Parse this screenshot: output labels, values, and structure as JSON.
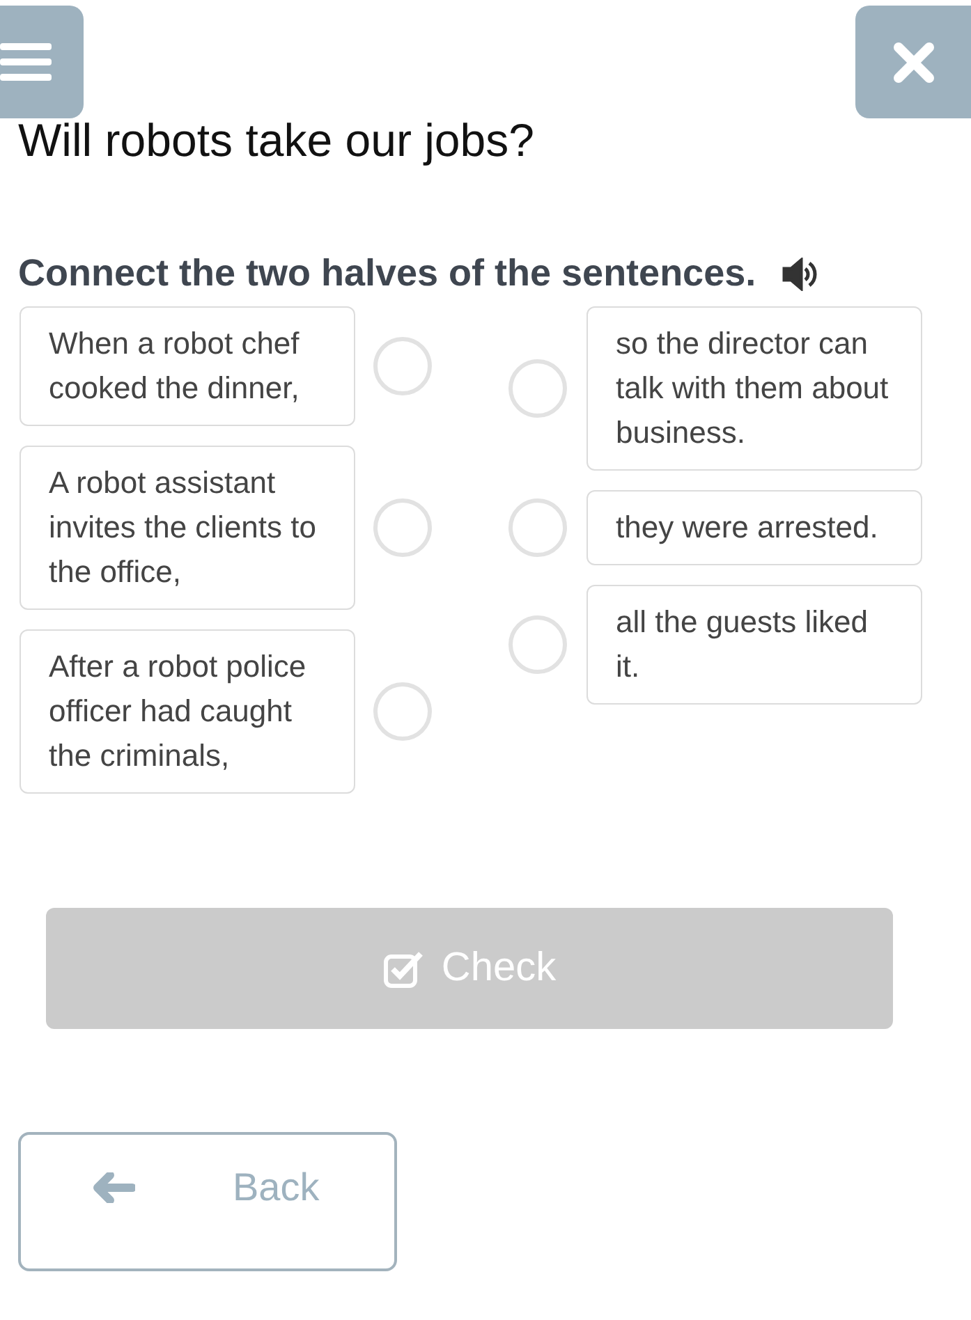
{
  "title": "Will robots take our jobs?",
  "instruction": "Connect the two halves of the sentences.",
  "left_items": [
    {
      "text": "When a robot chef cooked the dinner,",
      "selected": false
    },
    {
      "text": "A robot assistant invites the clients to the office,",
      "selected": false
    },
    {
      "text": "After a robot police officer had caught the criminals,",
      "selected": false
    }
  ],
  "right_items": [
    {
      "text": "so the director can talk with them about business.",
      "selected": false
    },
    {
      "text": "they were arrested.",
      "selected": false
    },
    {
      "text": "all the guests liked it.",
      "selected": false
    }
  ],
  "check_button": {
    "label": "Check",
    "disabled": true
  },
  "back_button": {
    "label": "Back"
  }
}
